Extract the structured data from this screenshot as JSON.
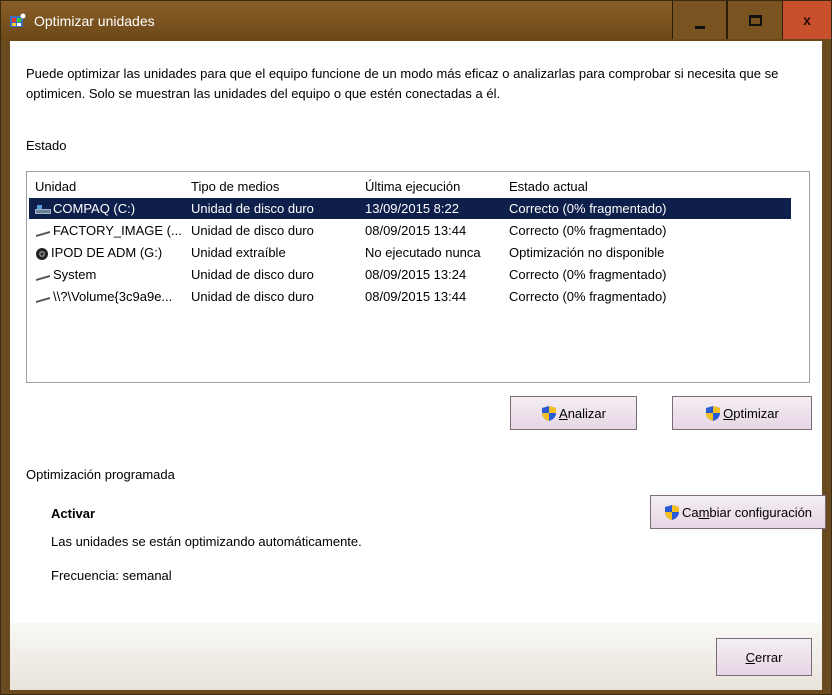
{
  "window": {
    "title": "Optimizar unidades",
    "controls": {
      "minimize": "minimize",
      "maximize": "maximize",
      "close": "x"
    }
  },
  "description": "Puede optimizar las unidades para que el equipo funcione de un modo más eficaz o analizarlas para comprobar si necesita que se optimicen. Solo se muestran las unidades del equipo o que estén conectadas a él.",
  "estado_label": "Estado",
  "table": {
    "columns": [
      "Unidad",
      "Tipo de medios",
      "Última ejecución",
      "Estado actual"
    ],
    "rows": [
      {
        "unidad": "COMPAQ (C:)",
        "tipo": "Unidad de disco duro",
        "ultima": "13/09/2015 8:22",
        "estado": "Correcto (0% fragmentado)",
        "icon": "system-drive-icon",
        "selected": true
      },
      {
        "unidad": "FACTORY_IMAGE (...",
        "tipo": "Unidad de disco duro",
        "ultima": "08/09/2015 13:44",
        "estado": "Correcto (0% fragmentado)",
        "icon": "hard-drive-icon"
      },
      {
        "unidad": "IPOD DE ADM (G:)",
        "tipo": "Unidad extraíble",
        "ultima": "No ejecutado nunca",
        "estado": "Optimización no disponible",
        "icon": "removable-drive-icon"
      },
      {
        "unidad": "System",
        "tipo": "Unidad de disco duro",
        "ultima": "08/09/2015 13:24",
        "estado": "Correcto (0% fragmentado)",
        "icon": "hard-drive-icon"
      },
      {
        "unidad": "\\\\?\\Volume{3c9a9e...",
        "tipo": "Unidad de disco duro",
        "ultima": "08/09/2015 13:44",
        "estado": "Correcto (0% fragmentado)",
        "icon": "hard-drive-icon"
      }
    ]
  },
  "buttons": {
    "analizar": {
      "accel": "A",
      "rest": "nalizar",
      "icon": "uac-shield-icon"
    },
    "optimizar": {
      "accel": "O",
      "rest": "ptimizar",
      "icon": "uac-shield-icon"
    },
    "cambiar": {
      "pre": "Ca",
      "accel": "m",
      "rest": "biar configuración",
      "icon": "uac-shield-icon"
    },
    "cerrar": {
      "accel": "C",
      "rest": "errar"
    }
  },
  "schedule": {
    "label": "Optimización programada",
    "activar": "Activar",
    "status": "Las unidades se están optimizando automáticamente.",
    "frequency": "Frecuencia: semanal"
  },
  "colors": {
    "titlebar": "#7a5420",
    "close_button": "#c9502c",
    "selection": "#0d1f4a"
  }
}
